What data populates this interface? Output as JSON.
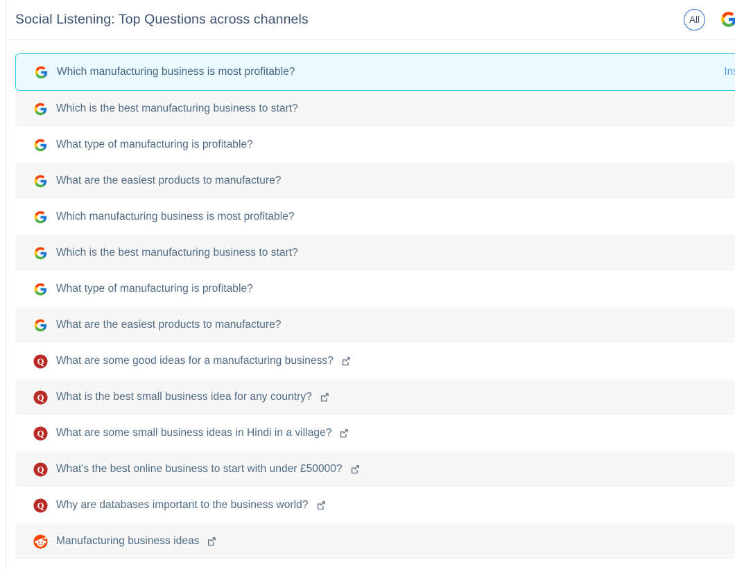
{
  "header": {
    "title": "Social Listening: Top Questions across channels",
    "filters": [
      {
        "name": "all",
        "label": "All",
        "type": "text"
      },
      {
        "name": "google",
        "label": "",
        "type": "google-icon"
      }
    ]
  },
  "colors": {
    "title": "#3d5170",
    "row_text": "#4e6a84",
    "selected_bg": "#eafaff",
    "selected_border": "#38c6e8",
    "alt_row_bg": "#f7f7f7",
    "action_link": "#4a9ff0",
    "quora_red": "#b92b27",
    "reddit_orange": "#ff4500"
  },
  "list": {
    "action_label": "Insert",
    "rows": [
      {
        "source": "google",
        "text": "Which manufacturing business is most profitable?",
        "selected": true,
        "external_link": false,
        "action": "Insert"
      },
      {
        "source": "google",
        "text": "Which is the best manufacturing business to start?",
        "selected": false,
        "external_link": false
      },
      {
        "source": "google",
        "text": "What type of manufacturing is profitable?",
        "selected": false,
        "external_link": false
      },
      {
        "source": "google",
        "text": "What are the easiest products to manufacture?",
        "selected": false,
        "external_link": false
      },
      {
        "source": "google",
        "text": "Which manufacturing business is most profitable?",
        "selected": false,
        "external_link": false
      },
      {
        "source": "google",
        "text": "Which is the best manufacturing business to start?",
        "selected": false,
        "external_link": false
      },
      {
        "source": "google",
        "text": "What type of manufacturing is profitable?",
        "selected": false,
        "external_link": false
      },
      {
        "source": "google",
        "text": "What are the easiest products to manufacture?",
        "selected": false,
        "external_link": false
      },
      {
        "source": "quora",
        "text": "What are some good ideas for a manufacturing business?",
        "selected": false,
        "external_link": true
      },
      {
        "source": "quora",
        "text": "What is the best small business idea for any country?",
        "selected": false,
        "external_link": true
      },
      {
        "source": "quora",
        "text": "What are some small business ideas in Hindi in a village?",
        "selected": false,
        "external_link": true
      },
      {
        "source": "quora",
        "text": "What's the best online business to start with under £50000?",
        "selected": false,
        "external_link": true
      },
      {
        "source": "quora",
        "text": "Why are databases important to the business world?",
        "selected": false,
        "external_link": true
      },
      {
        "source": "reddit",
        "text": "Manufacturing business ideas",
        "selected": false,
        "external_link": true
      }
    ]
  }
}
